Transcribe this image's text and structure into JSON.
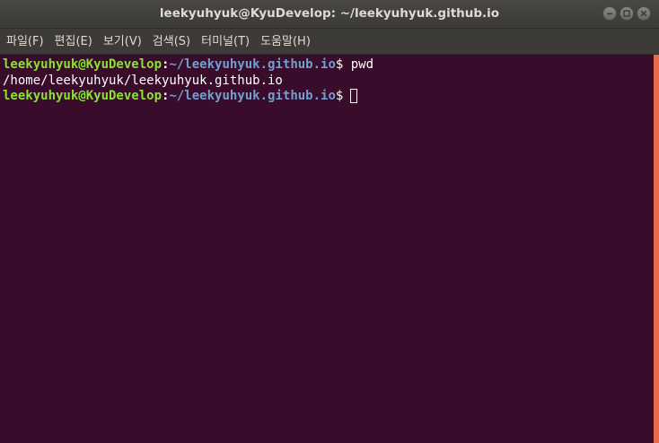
{
  "window": {
    "title": "leekyuhyuk@KyuDevelop: ~/leekyuhyuk.github.io"
  },
  "menu": [
    {
      "label": "파일(F)"
    },
    {
      "label": "편집(E)"
    },
    {
      "label": "보기(V)"
    },
    {
      "label": "검색(S)"
    },
    {
      "label": "터미널(T)"
    },
    {
      "label": "도움말(H)"
    }
  ],
  "terminal": {
    "line1": {
      "user": "leekyuhyuk@KyuDevelop",
      "colon": ":",
      "path": "~/leekyuhyuk.github.io",
      "prompt": "$ ",
      "command": "pwd"
    },
    "line2": {
      "output": "/home/leekyuhyuk/leekyuhyuk.github.io"
    },
    "line3": {
      "user": "leekyuhyuk@KyuDevelop",
      "colon": ":",
      "path": "~/leekyuhyuk.github.io",
      "prompt": "$"
    }
  },
  "colors": {
    "terminal_bg": "#380c2a",
    "user": "#8ae234",
    "path": "#729fcf",
    "scrollbar": "#e9684a",
    "titlebar": "#3c3b37"
  },
  "icons": {
    "minimize": "minimize-icon",
    "maximize": "maximize-icon",
    "close": "close-icon"
  }
}
